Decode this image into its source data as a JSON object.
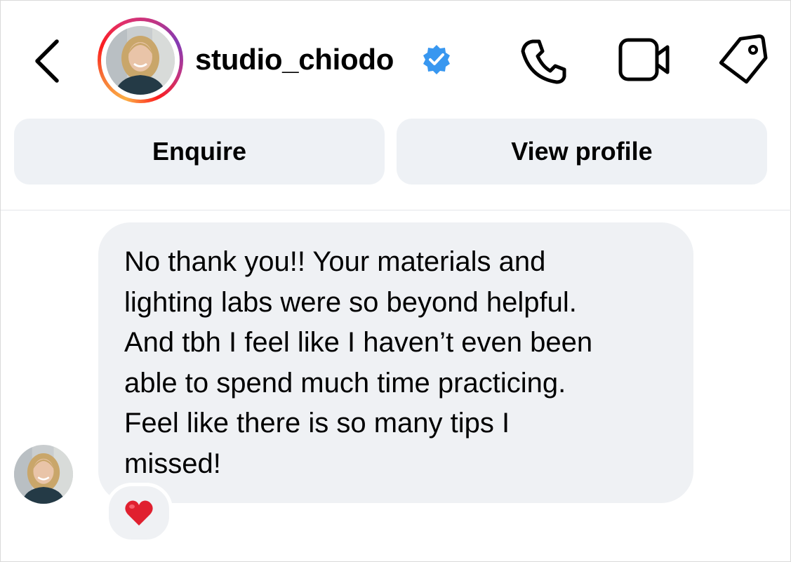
{
  "header": {
    "username": "studio_chiodo",
    "verified": true,
    "icons": {
      "back": "chevron-left-icon",
      "verified": "verified-badge-icon",
      "call": "phone-icon",
      "video": "video-camera-icon",
      "label": "tag-icon"
    },
    "colors": {
      "verified": "#3897f0",
      "story_ring": [
        "#fcaf45",
        "#fd1d1d",
        "#c13584",
        "#833ab4"
      ]
    }
  },
  "actions": {
    "enquire_label": "Enquire",
    "view_profile_label": "View profile"
  },
  "messages": [
    {
      "direction": "incoming",
      "text": "No thank you!! Your materials and\nlighting labs were so beyond helpful.\nAnd tbh I feel like I haven’t even been\nable to spend much time practicing.\nFeel like there is so many tips I\nmissed!",
      "reaction": "❤️"
    }
  ]
}
